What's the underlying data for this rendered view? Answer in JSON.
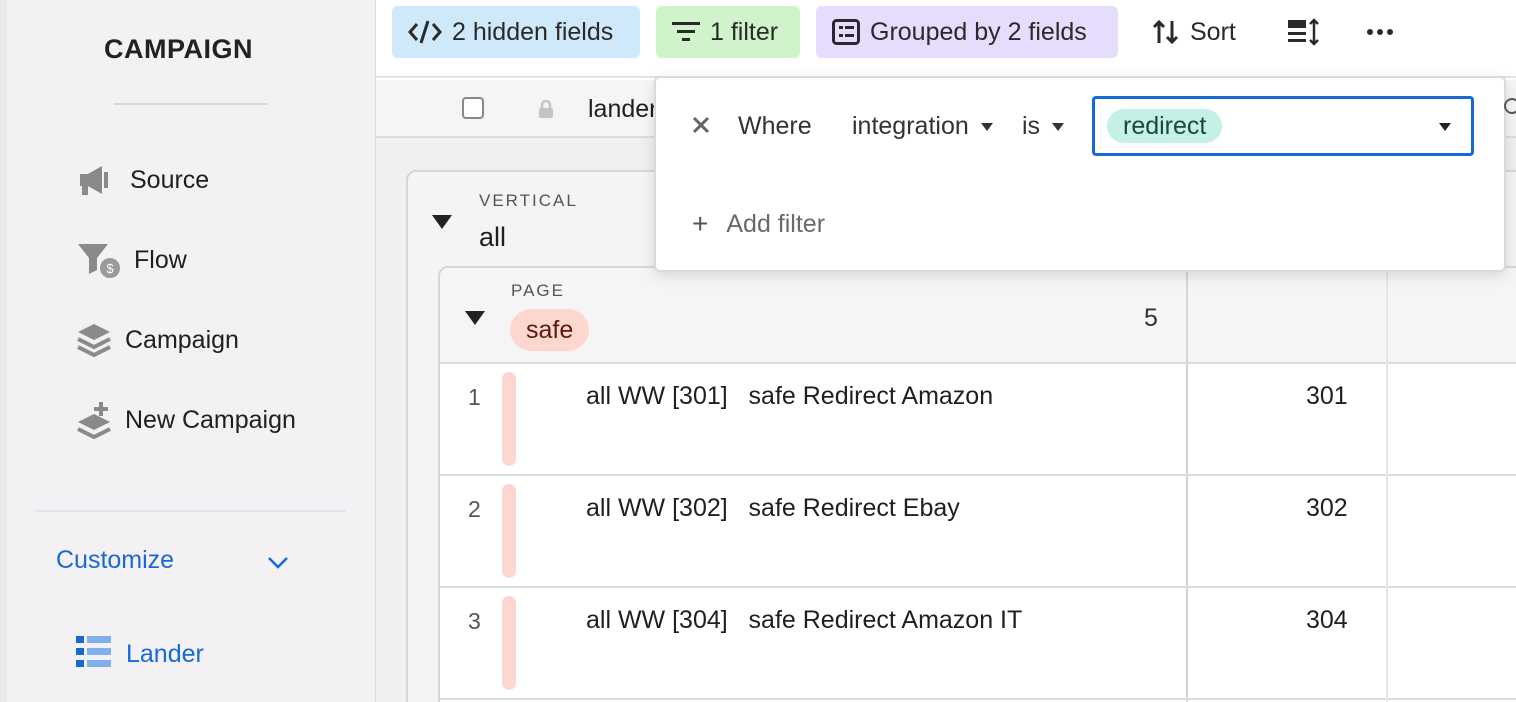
{
  "sidebar": {
    "brand": "CAMPAIGN",
    "items": [
      {
        "label": "Source",
        "icon": "megaphone-icon"
      },
      {
        "label": "Flow",
        "icon": "funnel-dollar-icon"
      },
      {
        "label": "Campaign",
        "icon": "layers-icon"
      },
      {
        "label": "New Campaign",
        "icon": "layers-add-icon"
      }
    ],
    "customize_label": "Customize",
    "active_view": {
      "label": "Lander",
      "icon": "list-icon"
    }
  },
  "toolbar": {
    "hidden_fields": "2 hidden fields",
    "filter": "1 filter",
    "grouped": "Grouped by 2 fields",
    "sort": "Sort"
  },
  "column_header": {
    "first_column": "lander"
  },
  "filter_popover": {
    "where": "Where",
    "field": "integration",
    "operator": "is",
    "value": "redirect",
    "add_filter": "Add filter"
  },
  "groups": {
    "vertical": {
      "label": "VERTICAL",
      "value": "all"
    },
    "page": {
      "label": "PAGE",
      "value": "safe",
      "count": "5"
    }
  },
  "rows": [
    {
      "num": "1",
      "name": "all WW [301]   safe Redirect Amazon",
      "code": "301"
    },
    {
      "num": "2",
      "name": "all WW [302]   safe Redirect Ebay",
      "code": "302"
    },
    {
      "num": "3",
      "name": "all WW [304]   safe Redirect Amazon IT",
      "code": "304"
    }
  ],
  "colors": {
    "accent": "#1769d6",
    "safe_pill": "#fcd7cf",
    "redirect_pill": "#c4f0e6",
    "hidden_chip": "#cfe9fb",
    "filter_chip": "#d0f3cc",
    "group_chip": "#e6dcfb"
  }
}
